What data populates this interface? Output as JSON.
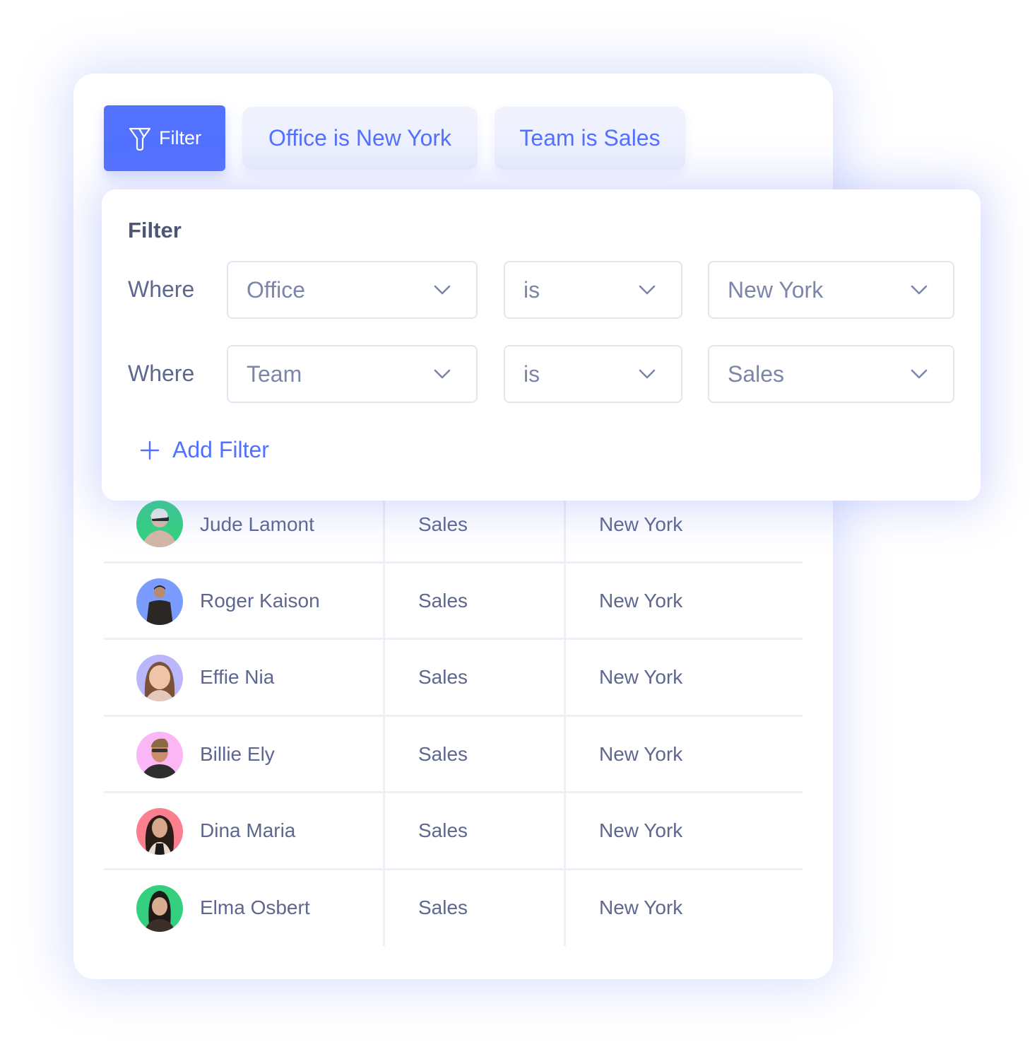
{
  "toolbar": {
    "filter_button_label": "Filter",
    "active_filters": [
      {
        "label": "Office is New York"
      },
      {
        "label": "Team is Sales"
      }
    ]
  },
  "filter_panel": {
    "title": "Filter",
    "rows": [
      {
        "prefix": "Where",
        "field": "Office",
        "operator": "is",
        "value": "New York"
      },
      {
        "prefix": "Where",
        "field": "Team",
        "operator": "is",
        "value": "Sales"
      }
    ],
    "add_filter_label": "Add Filter"
  },
  "table": {
    "rows": [
      {
        "name": "Jude Lamont",
        "team": "Sales",
        "office": "New York",
        "avatar_bg": "#34d07f"
      },
      {
        "name": "Roger Kaison",
        "team": "Sales",
        "office": "New York",
        "avatar_bg": "#7b9cff"
      },
      {
        "name": "Effie Nia",
        "team": "Sales",
        "office": "New York",
        "avatar_bg": "#b9b6fb"
      },
      {
        "name": "Billie Ely",
        "team": "Sales",
        "office": "New York",
        "avatar_bg": "#fbb6f5"
      },
      {
        "name": "Dina Maria",
        "team": "Sales",
        "office": "New York",
        "avatar_bg": "#fb7f8f"
      },
      {
        "name": "Elma Osbert",
        "team": "Sales",
        "office": "New York",
        "avatar_bg": "#34d07f"
      }
    ]
  },
  "colors": {
    "accent": "#5271ff",
    "chip_bg": "#eef1fd",
    "text": "#5d6790"
  }
}
